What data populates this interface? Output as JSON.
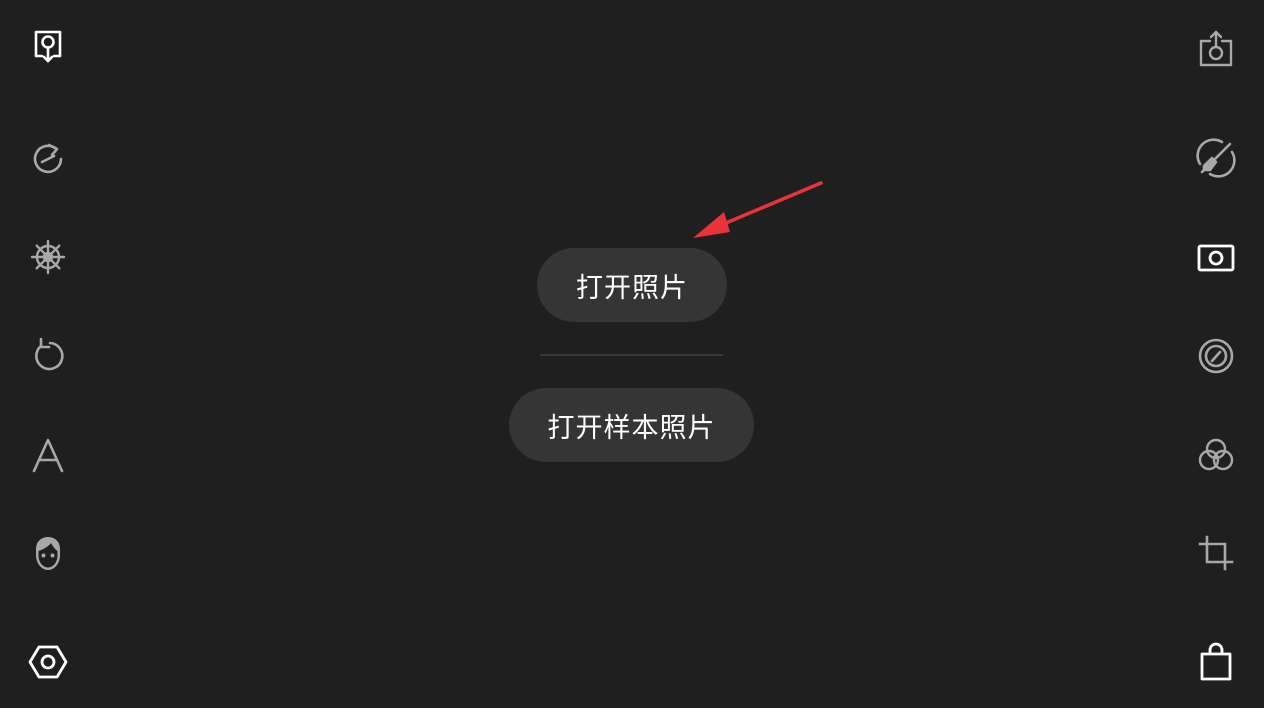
{
  "main": {
    "open_photo_label": "打开照片",
    "open_sample_label": "打开样本照片"
  },
  "colors": {
    "background": "#1f1f1f",
    "pill": "#353535",
    "icon_active": "#ffffff",
    "icon_inactive": "#a8a8a8",
    "annotation_arrow": "#e8333a"
  },
  "left_toolbar": [
    {
      "icon": "open-image-icon",
      "active": true
    },
    {
      "icon": "history-icon",
      "active": false
    },
    {
      "icon": "ship-wheel-icon",
      "active": false
    },
    {
      "icon": "undo-icon",
      "active": false
    },
    {
      "icon": "text-icon",
      "active": false
    },
    {
      "icon": "face-icon",
      "active": false
    },
    {
      "icon": "hexagon-settings-icon",
      "active": true
    }
  ],
  "right_toolbar": [
    {
      "icon": "export-icon",
      "active": false
    },
    {
      "icon": "brush-icon",
      "active": false
    },
    {
      "icon": "camera-icon",
      "active": true
    },
    {
      "icon": "vignette-icon",
      "active": false
    },
    {
      "icon": "color-circles-icon",
      "active": false
    },
    {
      "icon": "crop-icon",
      "active": false
    },
    {
      "icon": "shopping-bag-icon",
      "active": true
    }
  ]
}
